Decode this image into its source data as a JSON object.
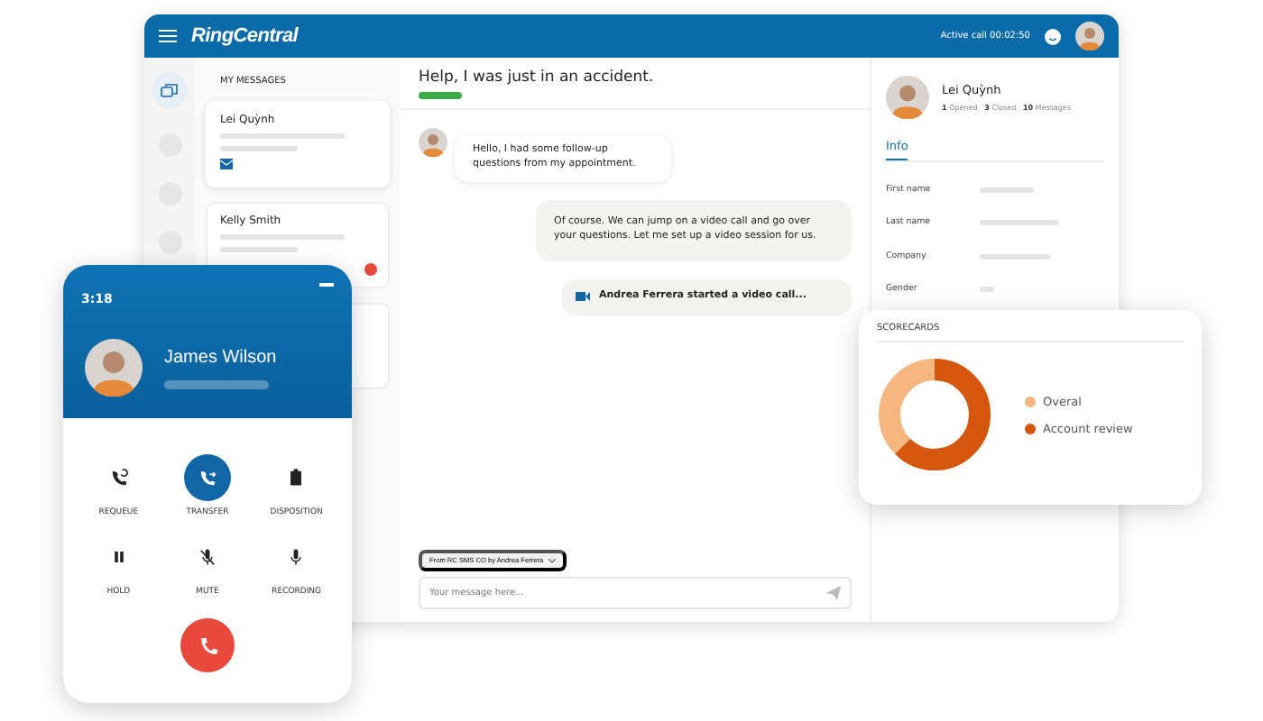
{
  "header": {
    "logo": "RingCentral",
    "active_call": "Active call 00:02:50"
  },
  "messages": {
    "title": "MY MESSAGES",
    "items": [
      {
        "name": "Lei Quỳnh",
        "selected": true,
        "kind": "mail"
      },
      {
        "name": "Kelly Smith",
        "selected": false,
        "kind": "alert"
      },
      {
        "selected": false,
        "kind": "none"
      }
    ]
  },
  "chat": {
    "title": "Help, I was just in an accident.",
    "messages": [
      {
        "kind": "incoming",
        "text": "Hello, I had some follow-up questions from my appointment."
      },
      {
        "kind": "outgoing",
        "text": "Of course. We can jump on a video call and go over your questions. Let me set up a video session for us."
      },
      {
        "kind": "system",
        "text": "Andrea Ferrera started a video call..."
      }
    ],
    "from": "From RC SMS CO by Andrea Ferrera",
    "composer": {
      "placeholder": "Your message here..."
    }
  },
  "contact": {
    "name": "Lei Quỳnh",
    "stats": [
      {
        "count": "1",
        "label": "Opened"
      },
      {
        "count": "3",
        "label": "Closed"
      },
      {
        "count": "10",
        "label": "Messages"
      }
    ],
    "tabs": [
      {
        "label": "Info",
        "selected": true
      }
    ],
    "fields": [
      {
        "label": "First name"
      },
      {
        "label": "Last name"
      },
      {
        "label": "Company"
      },
      {
        "label": "Gender"
      }
    ]
  },
  "scorecards": {
    "title": "SCORECARDS",
    "legend": [
      {
        "label": "Overal",
        "color": "#f5b77f"
      },
      {
        "label": "Account review",
        "color": "#d5570f"
      }
    ]
  },
  "phone": {
    "time": "3:18",
    "caller": "James Wilson",
    "actions": [
      {
        "label": "REQUEUE",
        "kind": "requeue",
        "selected": false
      },
      {
        "label": "TRANSFER",
        "kind": "transfer",
        "selected": true
      },
      {
        "label": "DISPOSITION",
        "kind": "clipboard",
        "selected": false
      },
      {
        "label": "HOLD",
        "kind": "pause",
        "selected": false
      },
      {
        "label": "MUTE",
        "kind": "mute",
        "selected": false
      },
      {
        "label": "RECORDING",
        "kind": "mic",
        "selected": false
      }
    ]
  }
}
